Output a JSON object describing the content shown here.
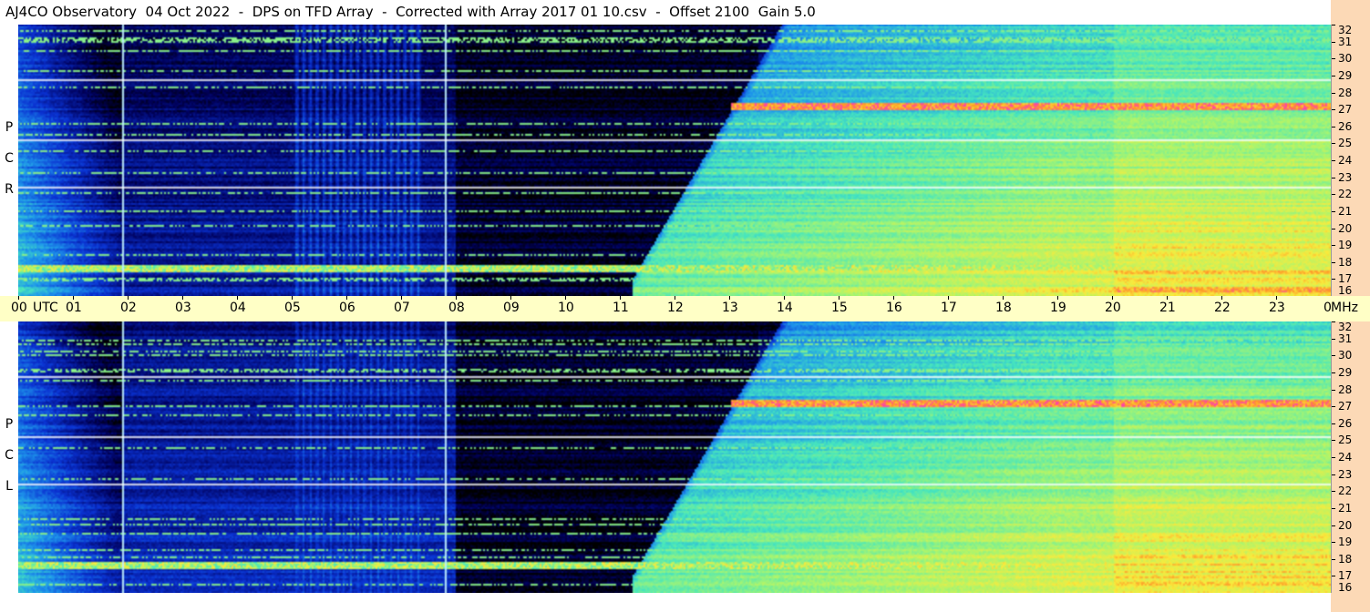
{
  "title": "AJ4CO Observatory  04 Oct 2022  -  DPS on TFD Array  -  Corrected with Array 2017 01 10.csv  -  Offset 2100  Gain 5.0",
  "panels": {
    "rcp": {
      "label": [
        "R",
        "C",
        "P"
      ]
    },
    "lcp": {
      "label": [
        "L",
        "C",
        "P"
      ]
    }
  },
  "freq_axis": {
    "unit": "MHz",
    "min": 16,
    "max": 32,
    "labels": [
      "32",
      "31",
      "30",
      "29",
      "28",
      "27",
      "26",
      "25",
      "24",
      "23",
      "22",
      "21",
      "20",
      "19",
      "18",
      "17",
      "16"
    ]
  },
  "time_axis": {
    "labels": [
      "00",
      "UTC",
      "01",
      "02",
      "03",
      "04",
      "05",
      "06",
      "07",
      "08",
      "09",
      "10",
      "11",
      "12",
      "13",
      "14",
      "15",
      "16",
      "17",
      "18",
      "19",
      "20",
      "21",
      "22",
      "23",
      "00"
    ]
  },
  "corner_label": "MHz",
  "colors": {
    "background": "#000000",
    "axis_bg_time": "#ffffc6",
    "axis_bg_freq": "#fcd9b6",
    "marker_line": "#bfefff"
  }
}
